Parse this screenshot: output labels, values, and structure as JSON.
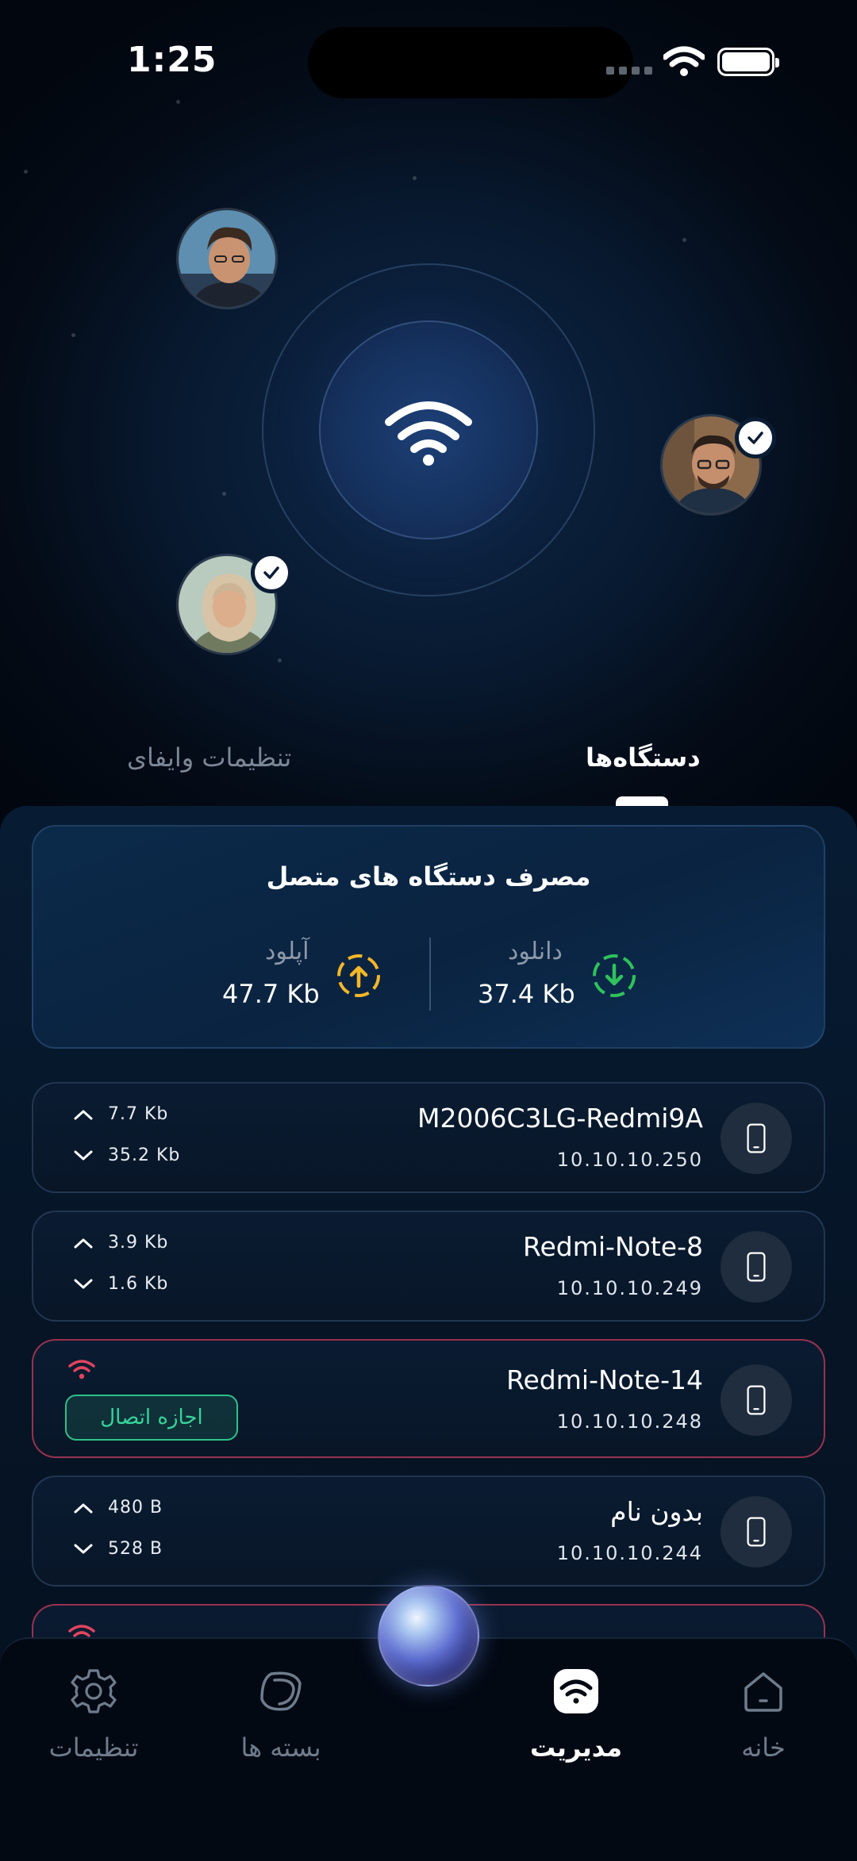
{
  "status_bar": {
    "time": "1:25"
  },
  "tabs": [
    {
      "label": "دستگاه‌ها",
      "active": true
    },
    {
      "label": "تنظیمات وایفای",
      "active": false
    }
  ],
  "usage": {
    "title": "مصرف دستگاه های متصل",
    "download": {
      "label": "دانلود",
      "value": "37.4 Kb",
      "icon": "download-arrow-icon",
      "color": "#2fc25b"
    },
    "upload": {
      "label": "آپلود",
      "value": "47.7 Kb",
      "icon": "upload-arrow-icon",
      "color": "#f5b72a"
    }
  },
  "devices": [
    {
      "name": "M2006C3LG-Redmi9A",
      "ip": "10.10.10.250",
      "up": "7.7 Kb",
      "down": "35.2 Kb",
      "blocked": false
    },
    {
      "name": "Redmi-Note-8",
      "ip": "10.10.10.249",
      "up": "3.9 Kb",
      "down": "1.6 Kb",
      "blocked": false
    },
    {
      "name": "Redmi-Note-14",
      "ip": "10.10.10.248",
      "blocked": true,
      "action_label": "اجازه اتصال"
    },
    {
      "name": "بدون نام",
      "ip": "10.10.10.244",
      "up": "480 B",
      "down": "528 B",
      "blocked": false
    }
  ],
  "nav": [
    {
      "label": "خانه",
      "icon": "home-icon",
      "active": false
    },
    {
      "label": "مدیریت",
      "icon": "wifi-management-icon",
      "active": true
    },
    {
      "label": "بسته ها",
      "icon": "packages-icon",
      "active": false
    },
    {
      "label": "تنظیمات",
      "icon": "settings-gear-icon",
      "active": false
    }
  ],
  "colors": {
    "accent_green": "#2fc08a",
    "blocked_red": "#c83c5a",
    "background": "#02070f"
  }
}
